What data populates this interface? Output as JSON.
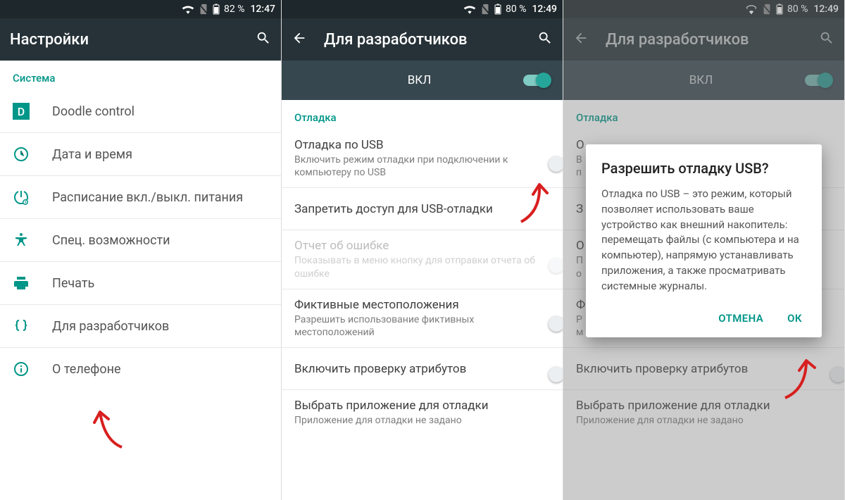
{
  "accent": "#009688",
  "panel1": {
    "status": {
      "battery_pct": "82 %",
      "time": "12:47"
    },
    "toolbar_title": "Настройки",
    "section_label": "Система",
    "items": [
      {
        "icon": "doodle",
        "title": "Doodle control"
      },
      {
        "icon": "clock",
        "title": "Дата и время"
      },
      {
        "icon": "power-sched",
        "title": "Расписание вкл./выкл. питания"
      },
      {
        "icon": "access",
        "title": "Спец. возможности"
      },
      {
        "icon": "printer",
        "title": "Печать"
      },
      {
        "icon": "braces",
        "title": "Для разработчиков"
      },
      {
        "icon": "info",
        "title": "О телефоне"
      }
    ]
  },
  "panel2": {
    "status": {
      "battery_pct": "80 %",
      "time": "12:49"
    },
    "toolbar_title": "Для разработчиков",
    "enable_label": "ВКЛ",
    "section_label": "Отладка",
    "items": [
      {
        "title": "Отладка по USB",
        "sub": "Включить режим отладки при подключении к компьютеру по USB",
        "switch": true,
        "on": false
      },
      {
        "title": "Запретить доступ для USB-отладки",
        "sub": ""
      },
      {
        "title": "Отчет об ошибке",
        "sub": "Показывать в меню кнопку для отправки отчета об ошибке",
        "switch": true,
        "on": false,
        "dim": true
      },
      {
        "title": "Фиктивные местоположения",
        "sub": "Разрешить использование фиктивных местоположений",
        "switch": true,
        "on": false
      },
      {
        "title": "Включить проверку атрибутов",
        "sub": "",
        "switch": true,
        "on": false
      },
      {
        "title": "Выбрать приложение для отладки",
        "sub": "Приложение для отладки не задано"
      }
    ]
  },
  "panel3": {
    "status": {
      "battery_pct": "80 %",
      "time": "12:49"
    },
    "toolbar_title": "Для разработчиков",
    "enable_label": "ВКЛ",
    "section_label": "Отладка",
    "bg_items": [
      {
        "title": "О",
        "sub": "В\nп"
      },
      {
        "title": "З"
      },
      {
        "title": "О",
        "sub": "П\nо"
      },
      {
        "title": "Ф",
        "sub": "Р\nм"
      },
      {
        "title": "Включить проверку атрибутов",
        "sub": "",
        "switch": true,
        "on": false
      },
      {
        "title": "Выбрать приложение для отладки",
        "sub": "Приложение для отладки не задано"
      }
    ],
    "dialog": {
      "title": "Разрешить отладку USB?",
      "body": "Отладка по USB – это режим, который позволяет использовать ваше устройство как внешний накопитель: перемещать файлы (с компьютера и на компьютер), напрямую устанавливать приложения, а также просматривать системные журналы.",
      "cancel": "ОТМЕНА",
      "ok": "ОК"
    }
  }
}
